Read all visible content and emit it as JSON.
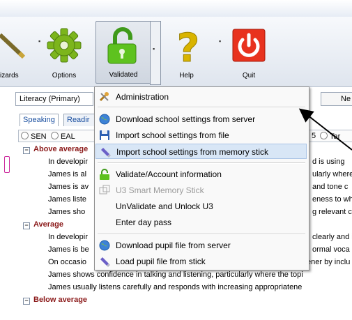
{
  "toolbar": {
    "buttons": [
      {
        "label": "izards"
      },
      {
        "label": "Options"
      },
      {
        "label": "Validated"
      },
      {
        "label": "Help"
      },
      {
        "label": "Quit"
      }
    ]
  },
  "selector": {
    "value": "Literacy (Primary)",
    "ne_text": "Ne"
  },
  "tabs": [
    "Speaking",
    "Readir"
  ],
  "radios": [
    "SEN",
    "EAL",
    "5",
    "Tar"
  ],
  "tree": [
    {
      "type": "group",
      "label": "Above average"
    },
    {
      "type": "item",
      "left": "In developir",
      "right": "d is using"
    },
    {
      "type": "item",
      "left": "James is al",
      "right": "ularly where"
    },
    {
      "type": "item",
      "left": "James is av",
      "right": "and tone c"
    },
    {
      "type": "item",
      "left": "James liste",
      "right": "eness to wh"
    },
    {
      "type": "item",
      "left": "James sho",
      "right": "g relevant c"
    },
    {
      "type": "group",
      "label": "Average"
    },
    {
      "type": "item",
      "left": "In developir",
      "right": "clearly and i"
    },
    {
      "type": "item",
      "left": "James is be",
      "right": "ormal voca"
    },
    {
      "type": "item",
      "left": "On occasio",
      "right": "ener by inclu"
    },
    {
      "type": "full",
      "text": "James shows confidence in talking and listening, particularly where the topi"
    },
    {
      "type": "full",
      "text": "James usually listens carefully and responds with increasing appropriatene"
    },
    {
      "type": "group",
      "label": "Below average"
    }
  ],
  "menu": {
    "items": [
      {
        "label": "Administration",
        "icon": "admin-tools-icon"
      },
      {
        "label": "Download school settings from server",
        "icon": "globe-icon"
      },
      {
        "label": "Import school settings from file",
        "icon": "floppy-disk-icon"
      },
      {
        "label": "Import school settings from memory stick",
        "icon": "memory-stick-icon"
      },
      {
        "label": "Validate/Account information",
        "icon": "unlocked-padlock-icon"
      },
      {
        "label": "U3 Smart Memory Stick",
        "icon": "u3-icon"
      },
      {
        "label": "UnValidate and Unlock U3",
        "icon": ""
      },
      {
        "label": "Enter day pass",
        "icon": ""
      },
      {
        "label": "Download pupil file from server",
        "icon": "globe-icon"
      },
      {
        "label": "Load pupil file from stick",
        "icon": "memory-stick-icon"
      }
    ]
  },
  "colors": {
    "accent_green": "#4caf1e",
    "quit_red": "#e8321e",
    "help_yellow": "#d9b400",
    "highlight": "#d8e6f6"
  }
}
